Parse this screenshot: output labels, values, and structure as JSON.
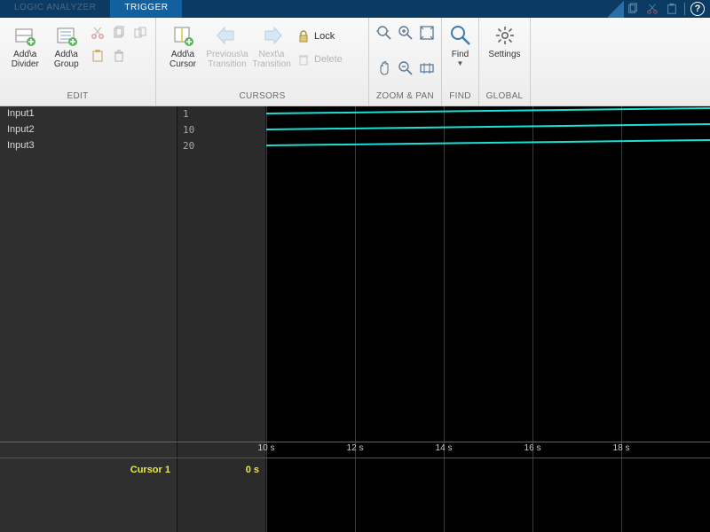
{
  "tabs": {
    "analyzer": "LOGIC ANALYZER",
    "trigger": "TRIGGER"
  },
  "ribbon": {
    "edit": {
      "label": "EDIT",
      "add_divider": "Add\\a\nDivider",
      "add_group": "Add\\a\nGroup"
    },
    "cursors": {
      "label": "CURSORS",
      "add_cursor": "Add\\a\nCursor",
      "prev": "Previous\\a\nTransition",
      "next": "Next\\a\nTransition",
      "lock": "Lock",
      "delete": "Delete"
    },
    "zoom": {
      "label": "ZOOM & PAN"
    },
    "find": {
      "label": "FIND",
      "find": "Find"
    },
    "global": {
      "label": "GLOBAL",
      "settings": "Settings"
    }
  },
  "signals": [
    {
      "name": "Input1",
      "value": "1"
    },
    {
      "name": "Input2",
      "value": "10"
    },
    {
      "name": "Input3",
      "value": "20"
    }
  ],
  "axis": {
    "ticks": [
      {
        "pos": 0,
        "label": "10 s"
      },
      {
        "pos": 100,
        "label": "12 s"
      },
      {
        "pos": 200,
        "label": "14 s"
      },
      {
        "pos": 300,
        "label": "16 s"
      },
      {
        "pos": 400,
        "label": "18 s"
      }
    ]
  },
  "cursor": {
    "label": "Cursor 1",
    "value": "0 s"
  },
  "help": "?"
}
